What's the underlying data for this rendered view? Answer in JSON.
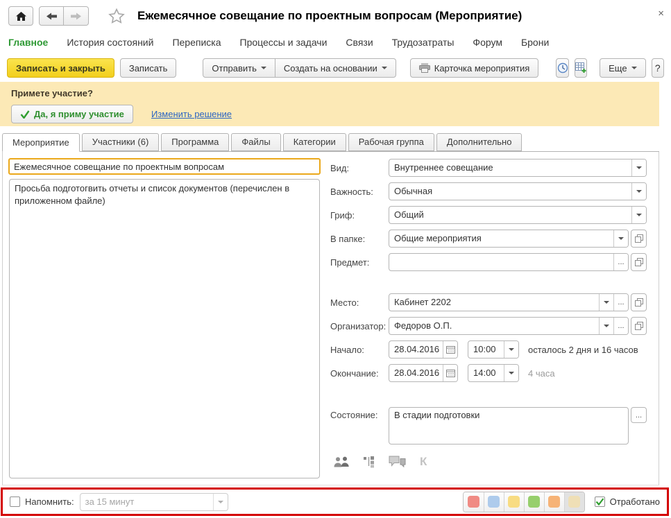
{
  "window": {
    "title": "Ежемесячное совещание по проектным вопросам (Мероприятие)",
    "close_glyph": "×"
  },
  "menu": {
    "items": [
      {
        "label": "Главное",
        "active": true
      },
      {
        "label": "История состояний"
      },
      {
        "label": "Переписка"
      },
      {
        "label": "Процессы и задачи"
      },
      {
        "label": "Связи"
      },
      {
        "label": "Трудозатраты"
      },
      {
        "label": "Форум"
      },
      {
        "label": "Брони"
      }
    ]
  },
  "toolbar": {
    "save_close": "Записать и закрыть",
    "save": "Записать",
    "send": "Отправить",
    "create_from": "Создать на основании",
    "event_card": "Карточка мероприятия",
    "more": "Еще",
    "help": "?"
  },
  "banner": {
    "question": "Примете участие?",
    "accept": "Да, я приму участие",
    "change_link": "Изменить решение",
    "background": "#FCE9B6"
  },
  "tabs": [
    {
      "label": "Мероприятие",
      "active": true
    },
    {
      "label": "Участники (6)"
    },
    {
      "label": "Программа"
    },
    {
      "label": "Файлы"
    },
    {
      "label": "Категории"
    },
    {
      "label": "Рабочая группа"
    },
    {
      "label": "Дополнительно"
    }
  ],
  "form": {
    "subject": "Ежемесячное совещание по проектным вопросам",
    "description": "Просьба подготогвить отчеты и список документов (перечислен в приложенном файле)",
    "kind": {
      "label": "Вид:",
      "value": "Внутреннее совещание"
    },
    "importance": {
      "label": "Важность:",
      "value": "Обычная"
    },
    "grif": {
      "label": "Гриф:",
      "value": "Общий"
    },
    "folder": {
      "label": "В папке:",
      "value": "Общие мероприятия"
    },
    "subject_ref": {
      "label": "Предмет:",
      "value": ""
    },
    "place": {
      "label": "Место:",
      "value": "Кабинет 2202"
    },
    "organizer": {
      "label": "Организатор:",
      "value": "Федоров О.П."
    },
    "start": {
      "label": "Начало:",
      "date": "28.04.2016",
      "time": "10:00",
      "hint": "осталось 2 дня и 16 часов"
    },
    "end": {
      "label": "Окончание:",
      "date": "28.04.2016",
      "time": "14:00",
      "hint": "4 часа"
    },
    "state": {
      "label": "Состояние:",
      "value": "В стадии подготовки"
    },
    "k_letter": "К",
    "subject_highlight_border": "#EBA81A"
  },
  "footer": {
    "remind_label": "Напомнить:",
    "remind_value": "за 15 минут",
    "done_label": "Отработано",
    "annotation_border": "#D40000",
    "swatches": [
      {
        "name": "red",
        "color": "#F08B84"
      },
      {
        "name": "blue",
        "color": "#AECBEC"
      },
      {
        "name": "yellow",
        "color": "#F8DC82"
      },
      {
        "name": "green",
        "color": "#97CF6C"
      },
      {
        "name": "orange",
        "color": "#F6B377"
      },
      {
        "name": "beige",
        "color": "#EFDFB6",
        "selected": true
      }
    ]
  },
  "ui": {
    "ellipsis": "..."
  }
}
